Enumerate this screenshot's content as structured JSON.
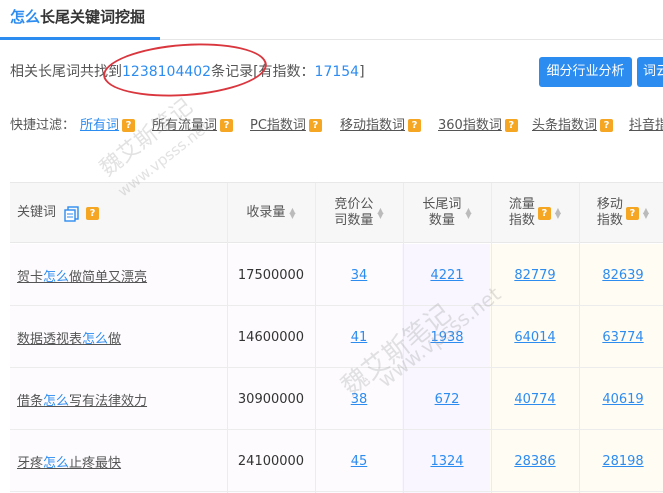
{
  "title": {
    "prefix": "怎么",
    "rest": "长尾关键词挖掘"
  },
  "summary": {
    "before": "相关长尾词共找到",
    "count": "1238104402",
    "middle": "条记录[有指数：",
    "indexed": "17154",
    "after": "]"
  },
  "buttons": {
    "industry": "细分行业分析",
    "cloud": "词云"
  },
  "filters": {
    "label": "快捷过滤：",
    "items": [
      "所有词",
      "所有流量词",
      "PC指数词",
      "移动指数词",
      "360指数词",
      "头条指数词",
      "抖音指"
    ]
  },
  "table": {
    "headers": [
      "关键词",
      "收录量",
      "竞价公\n司数量",
      "长尾词\n数量",
      "流量\n指数",
      "移动\n指数"
    ],
    "rows": [
      {
        "kw_pre": "贺卡",
        "kw_hl": "怎么",
        "kw_post": "做简单又漂亮",
        "indexed": "17500000",
        "bid": "34",
        "longtail": "4221",
        "traffic": "82779",
        "mobile": "82639"
      },
      {
        "kw_pre": "数据透视表",
        "kw_hl": "怎么",
        "kw_post": "做",
        "indexed": "14600000",
        "bid": "41",
        "longtail": "1938",
        "traffic": "64014",
        "mobile": "63774"
      },
      {
        "kw_pre": "借条",
        "kw_hl": "怎么",
        "kw_post": "写有法律效力",
        "indexed": "30900000",
        "bid": "38",
        "longtail": "672",
        "traffic": "40774",
        "mobile": "40619"
      },
      {
        "kw_pre": "牙疼",
        "kw_hl": "怎么",
        "kw_post": "止疼最快",
        "indexed": "24100000",
        "bid": "45",
        "longtail": "1324",
        "traffic": "28386",
        "mobile": "28198"
      }
    ]
  },
  "watermarks": [
    "魏艾斯笔记",
    "www.vpsss.net"
  ],
  "colors": {
    "accent": "#2d8cf0",
    "help": "#f5a623",
    "circle": "#d9363e"
  }
}
